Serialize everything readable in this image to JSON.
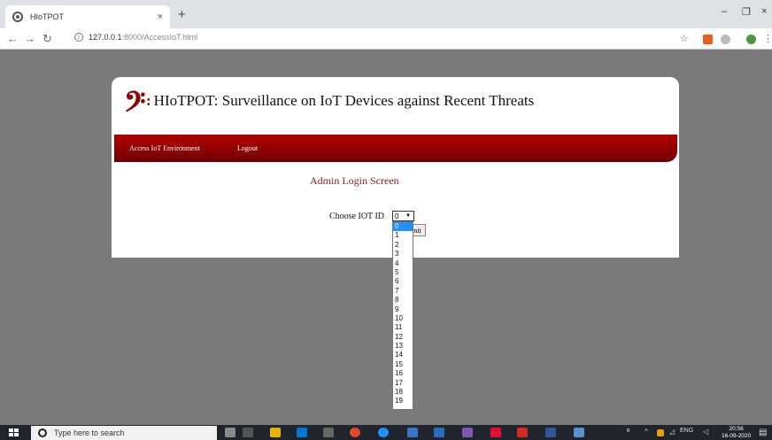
{
  "browser": {
    "tab_title": "HIoTPOT",
    "tab_close": "×",
    "new_tab": "+",
    "win_minimize": "–",
    "win_maximize": "❐",
    "win_close": "×",
    "url_host": "127.0.0.1",
    "url_path": ":8000/AccessIoT.html",
    "star": "☆",
    "menu": "⋮"
  },
  "page": {
    "logo_glyph": "𝄢",
    "logo_colon": ":",
    "site_title": "HIoTPOT: Surveillance on IoT Devices against Recent Threats",
    "menu": {
      "access_iot": "Access IoT Environment",
      "logout": "Logout"
    },
    "heading": "Admin Login Screen",
    "form": {
      "label": "Choose IOT ID",
      "selected": "0",
      "submit_label": "Submit",
      "options": [
        "0",
        "1",
        "2",
        "3",
        "4",
        "5",
        "6",
        "7",
        "8",
        "9",
        "10",
        "11",
        "12",
        "13",
        "14",
        "15",
        "16",
        "17",
        "18",
        "19"
      ]
    }
  },
  "taskbar": {
    "search_placeholder": "Type here to search",
    "time": "20:56",
    "date": "16-09-2020",
    "lang": "ENG"
  },
  "colors": {
    "brand": "#8b0000",
    "menubar": "#b30000",
    "selection": "#1e90ff"
  }
}
